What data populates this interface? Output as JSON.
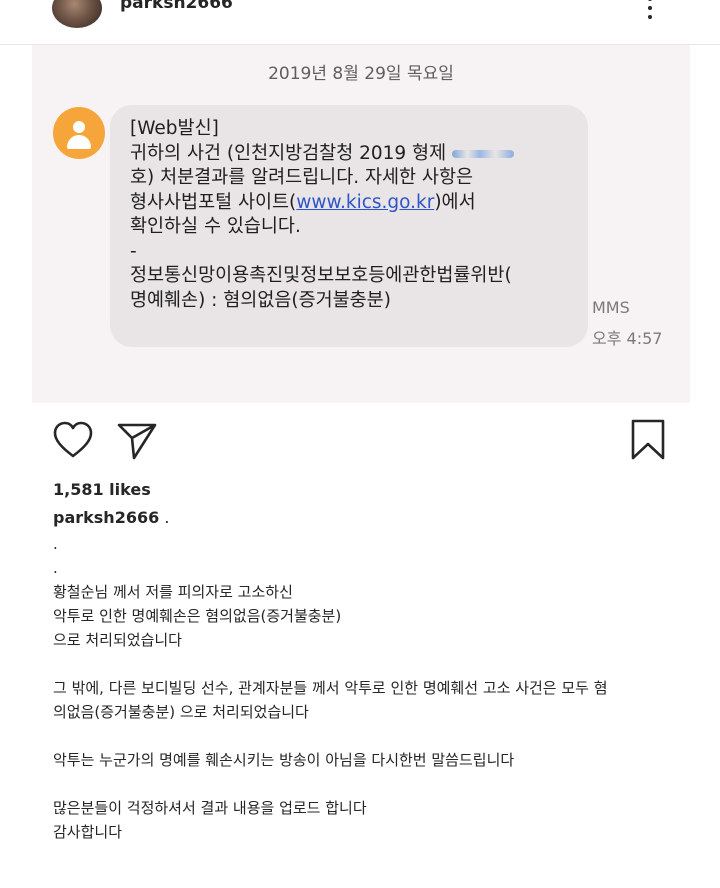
{
  "header": {
    "username": "parksh2666"
  },
  "photo": {
    "message_date": "2019년 8월 29일 목요일",
    "bubble": {
      "line1": "[Web발신]",
      "line2": "귀하의 사건 (인천지방검찰청 2019 형제 ",
      "line3": "호) 처분결과를 알려드립니다. 자세한 사항은",
      "line4_pre": "형사사법포털 사이트(",
      "line4_link": "www.kics.go.kr",
      "line4_post": ")에서",
      "line5": "확인하실 수 있습니다.",
      "line6": "-",
      "line7": "정보통신망이용촉진및정보보호등에관한법률위반(",
      "line8": "명예훼손) : 혐의없음(증거불충분)"
    },
    "mms_label": "MMS",
    "mms_time": "오후 4:57"
  },
  "post": {
    "likes": "1,581 likes",
    "caption_username": "parksh2666",
    "caption_suffix": " .",
    "caption_lines": {
      "l1": ".",
      "l2": ".",
      "l3": "황철순님 께서 저를 피의자로 고소하신",
      "l4": "악투로 인한 명예훼손은 혐의없음(증거불충분)",
      "l5": "으로 처리되었습니다",
      "l6": "그 밖에, 다른 보디빌딩 선수, 관계자분들 께서 악투로 인한 명예훼선 고소 사건은 모두 혐",
      "l7": "의없음(증거불충분) 으로 처리되었습니다",
      "l8": "악투는 누군가의 명예를 훼손시키는 방송이 아님을 다시한번 말씀드립니다",
      "l9": "많은분들이 걱정하셔서 결과 내용을 업로드 합니다",
      "l10": "감사합니다"
    }
  },
  "icons": {
    "like": "heart-icon",
    "share": "send-icon",
    "save": "bookmark-icon",
    "more": "more-icon",
    "sender": "person-icon"
  }
}
